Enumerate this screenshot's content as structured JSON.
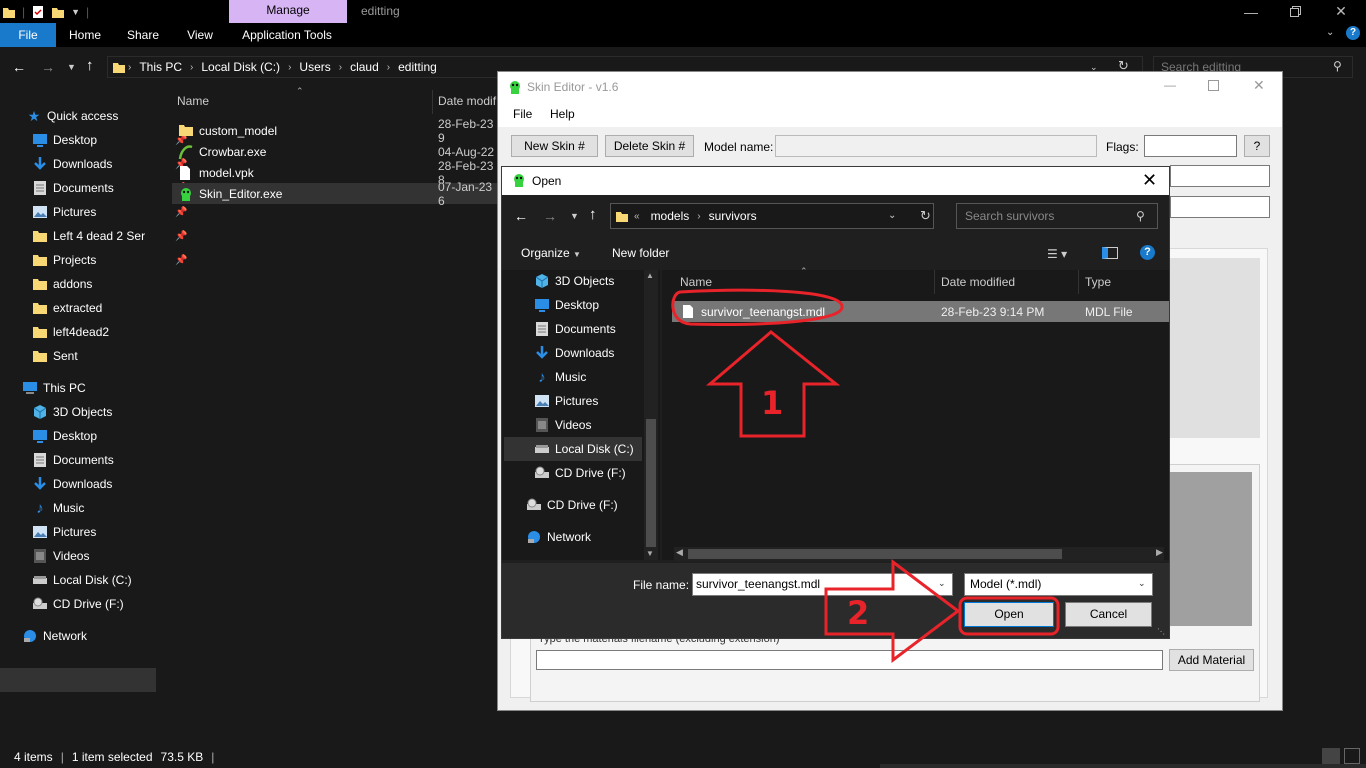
{
  "explorer": {
    "contextual_tab": "Manage",
    "window_title": "editting",
    "ribbon_tabs": [
      "File",
      "Home",
      "Share",
      "View",
      "Application Tools"
    ],
    "breadcrumb": [
      "This PC",
      "Local Disk (C:)",
      "Users",
      "claud",
      "editting"
    ],
    "search_placeholder": "Search editting",
    "columns": {
      "name": "Name",
      "date": "Date modif"
    },
    "files": [
      {
        "name": "custom_model",
        "date": "28-Feb-23 9",
        "icon": "folder-icon"
      },
      {
        "name": "Crowbar.exe",
        "date": "04-Aug-22",
        "icon": "crowbar-icon"
      },
      {
        "name": "model.vpk",
        "date": "28-Feb-23 8",
        "icon": "file-icon"
      },
      {
        "name": "Skin_Editor.exe",
        "date": "07-Jan-23 6",
        "icon": "skin-editor-icon"
      }
    ],
    "nav": {
      "quick_access": "Quick access",
      "quick_items": [
        "Desktop",
        "Downloads",
        "Documents",
        "Pictures",
        "Left 4 dead 2 Ser",
        "Projects",
        "addons",
        "extracted",
        "left4dead2",
        "Sent"
      ],
      "this_pc": "This PC",
      "pc_items": [
        "3D Objects",
        "Desktop",
        "Documents",
        "Downloads",
        "Music",
        "Pictures",
        "Videos",
        "Local Disk (C:)",
        "CD Drive (F:)"
      ],
      "network": "Network"
    },
    "status": {
      "count": "4 items",
      "selected": "1 item selected",
      "size": "73.5 KB"
    }
  },
  "skin_editor": {
    "title": "Skin Editor - v1.6",
    "menu": [
      "File",
      "Help"
    ],
    "new_skin_button": "New Skin #",
    "delete_skin_button": "Delete Skin #",
    "model_name_label": "Model name:",
    "flags_label": "Flags:",
    "help_button": "?",
    "material_hint": "Type the materials filename (excluding extension)",
    "add_material_button": "Add Material"
  },
  "open_dialog": {
    "title": "Open",
    "path": [
      "models",
      "survivors"
    ],
    "search_placeholder": "Search survivors",
    "organize": "Organize",
    "new_folder": "New folder",
    "nav_items": [
      "3D Objects",
      "Desktop",
      "Documents",
      "Downloads",
      "Music",
      "Pictures",
      "Videos",
      "Local Disk (C:)",
      "CD Drive (F:)",
      "CD Drive (F:)",
      "Network"
    ],
    "columns": {
      "name": "Name",
      "date": "Date modified",
      "type": "Type"
    },
    "file": {
      "name": "survivor_teenangst.mdl",
      "date": "28-Feb-23 9:14 PM",
      "type": "MDL File"
    },
    "filename_label": "File name:",
    "filename_value": "survivor_teenangst.mdl",
    "filter_value": "Model (*.mdl)",
    "open_button": "Open",
    "cancel_button": "Cancel"
  },
  "annotations": {
    "step1": "1",
    "step2": "2",
    "color": "#e8232a"
  }
}
